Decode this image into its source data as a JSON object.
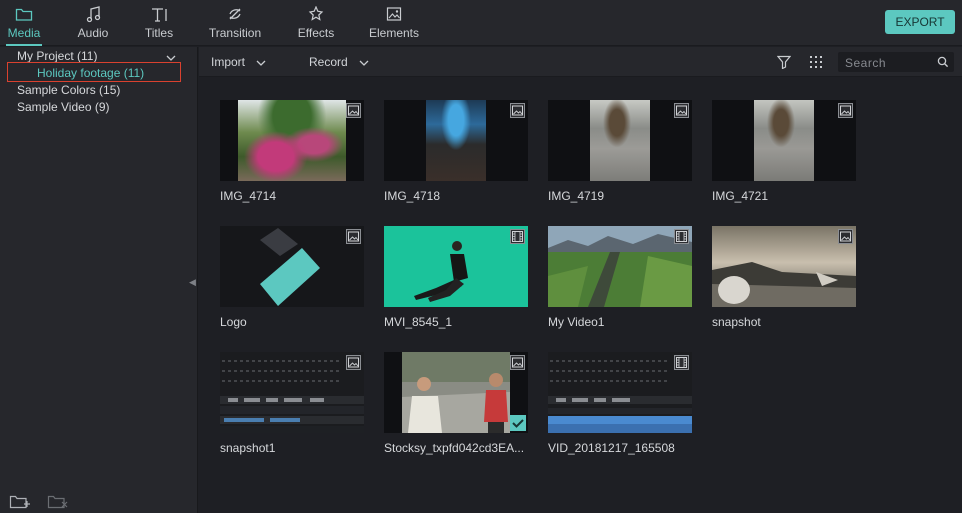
{
  "toolbar": {
    "tabs": [
      {
        "label": "Media",
        "icon": "folder-icon",
        "active": true
      },
      {
        "label": "Audio",
        "icon": "music-note-icon",
        "active": false
      },
      {
        "label": "Titles",
        "icon": "text-icon",
        "active": false
      },
      {
        "label": "Transition",
        "icon": "transition-icon",
        "active": false
      },
      {
        "label": "Effects",
        "icon": "effects-icon",
        "active": false
      },
      {
        "label": "Elements",
        "icon": "image-icon",
        "active": false
      }
    ],
    "export_label": "EXPORT",
    "accent_color": "#5cc8c0"
  },
  "sidebar": {
    "items": [
      {
        "label": "My Project (11)",
        "level": 0,
        "expanded": true
      },
      {
        "label": "Holiday footage (11)",
        "level": 1,
        "selected": true
      },
      {
        "label": "Sample Colors (15)",
        "level": 0
      },
      {
        "label": "Sample Video (9)",
        "level": 0
      }
    ],
    "bottom_icons": [
      "add-folder-icon",
      "delete-folder-icon"
    ]
  },
  "subbar": {
    "import_label": "Import",
    "record_label": "Record",
    "search_placeholder": "Search"
  },
  "media": [
    {
      "name": "IMG_4714",
      "type": "image"
    },
    {
      "name": "IMG_4718",
      "type": "image"
    },
    {
      "name": "IMG_4719",
      "type": "image"
    },
    {
      "name": "IMG_4721",
      "type": "image"
    },
    {
      "name": "Logo",
      "type": "image"
    },
    {
      "name": "MVI_8545_1",
      "type": "video"
    },
    {
      "name": "My Video1",
      "type": "video"
    },
    {
      "name": "snapshot",
      "type": "image"
    },
    {
      "name": "snapshot1",
      "type": "image"
    },
    {
      "name": "Stocksy_txpfd042cd3EA...",
      "type": "image",
      "used": true
    },
    {
      "name": "VID_20181217_165508",
      "type": "video"
    }
  ]
}
